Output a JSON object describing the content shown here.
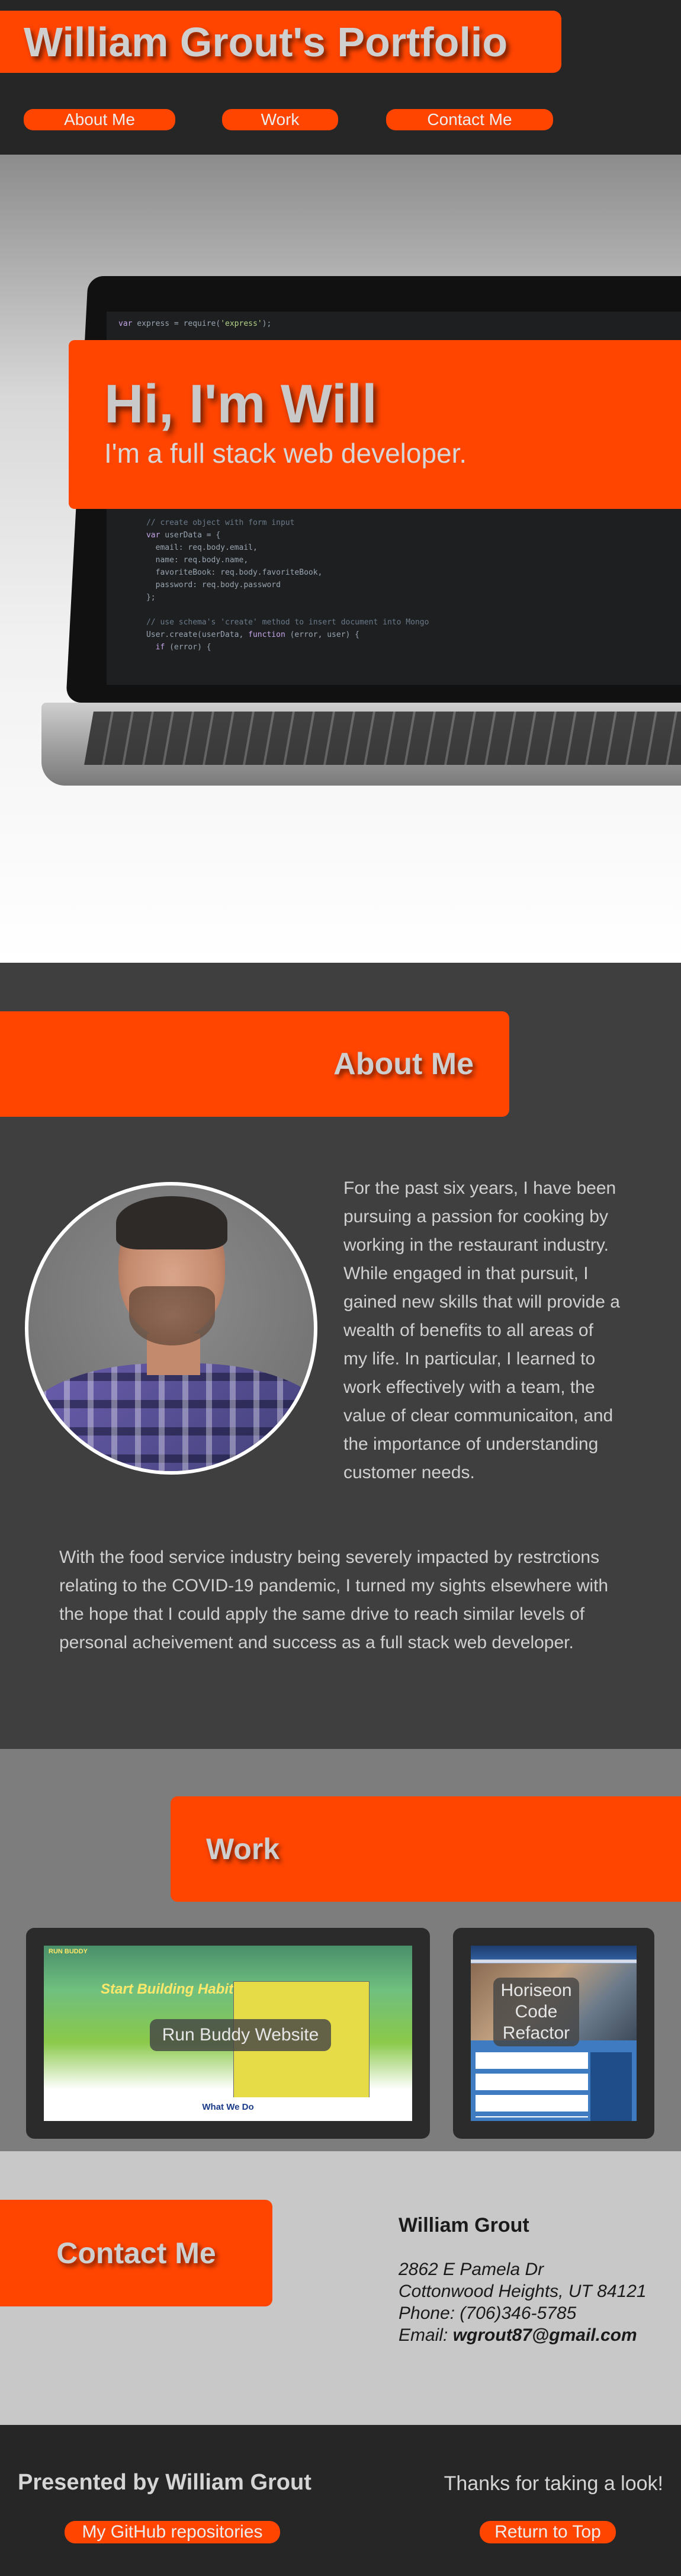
{
  "header": {
    "title": "William Grout's Portfolio",
    "nav": [
      {
        "label": "About Me"
      },
      {
        "label": "Work"
      },
      {
        "label": "Contact Me"
      }
    ]
  },
  "hero": {
    "heading": "Hi, I'm Will",
    "subheading": "I'm a full stack web developer."
  },
  "about": {
    "title": "About Me",
    "paragraph1": "For the past six years, I have been pursuing a passion for cooking by working in the restaurant industry. While engaged in that pursuit, I gained new skills that will provide a wealth of benefits to all areas of my life. In particular, I learned to work effectively with a team, the value of clear communicaiton, and the importance of understanding customer needs.",
    "paragraph2": "With the food service industry being severely impacted by restrctions relating to the COVID-19 pandemic, I turned my sights elsewhere with the hope that I could apply the same drive to reach similar levels of personal acheivement and success as a full stack web developer."
  },
  "work": {
    "title": "Work",
    "projects": [
      {
        "label": "Run Buddy Website",
        "screenshot_heading": "Start Building Habits",
        "screenshot_footer": "What We Do"
      },
      {
        "label": "Horiseon Code Refactor"
      }
    ]
  },
  "contact": {
    "title": "Contact Me",
    "name": "William Grout",
    "street": "2862 E Pamela Dr",
    "city": "Cottonwood Heights, UT 84121",
    "phone": "Phone: (706)346-5785",
    "email_label": "Email:",
    "email": "wgrout87@gmail.com"
  },
  "footer": {
    "presented_by": "Presented by William Grout",
    "thanks": "Thanks for taking a look!",
    "github_label": "My GitHub repositories",
    "top_label": "Return to Top"
  },
  "colors": {
    "accent": "#ff4500",
    "header_bg": "#262626",
    "about_bg": "#3f3f3f",
    "work_bg": "#7d7d7d",
    "contact_bg": "#c8c8c8"
  }
}
